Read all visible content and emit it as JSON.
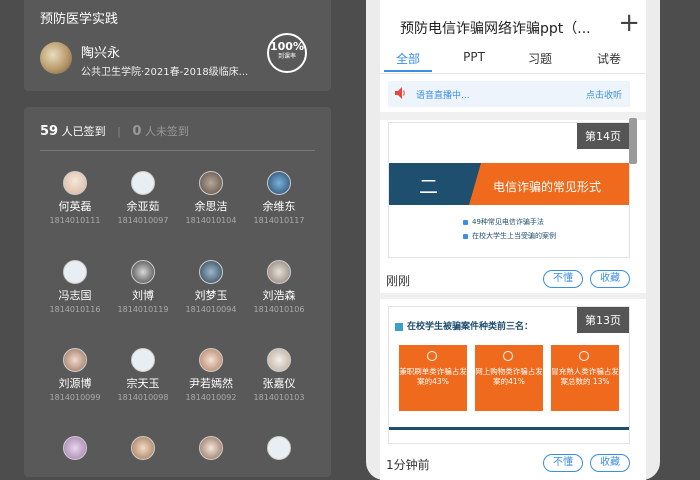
{
  "course": {
    "title": "预防医学实践",
    "teacher_name": "陶兴永",
    "teacher_info": "公共卫生学院·2021春-2018级临床...",
    "rate_value": "100%",
    "rate_label": "到课率"
  },
  "signin": {
    "signed_count": "59",
    "signed_label": "人已签到",
    "unsigned_count": "0",
    "unsigned_label": "人未签到"
  },
  "students": [
    {
      "name": "何英磊",
      "id": "1814010111"
    },
    {
      "name": "余亚茹",
      "id": "1814010097"
    },
    {
      "name": "余思洁",
      "id": "1814010104"
    },
    {
      "name": "余维东",
      "id": "1814010117"
    },
    {
      "name": "冯志国",
      "id": "1814010116"
    },
    {
      "name": "刘博",
      "id": "1814010119"
    },
    {
      "name": "刘梦玉",
      "id": "1814010094"
    },
    {
      "name": "刘浩森",
      "id": "1814010106"
    },
    {
      "name": "刘源博",
      "id": "1814010099"
    },
    {
      "name": "宗天玉",
      "id": "1814010098"
    },
    {
      "name": "尹若嫣然",
      "id": "1814010092"
    },
    {
      "name": "张嘉仪",
      "id": "1814010103"
    }
  ],
  "phone": {
    "title": "预防电信诈骗网络诈骗ppt（...",
    "plus_label": "+",
    "tabs": [
      "全部",
      "PPT",
      "习题",
      "试卷"
    ],
    "notice_text": "语音直播中...",
    "notice_action": "点击收听",
    "slide1": {
      "page": "第14页",
      "number": "二",
      "heading": "电信诈骗的常见形式",
      "bullet1": "49种常见电信诈骗手法",
      "bullet2": "在校大学生上当受骗的案例",
      "time": "刚刚",
      "btn_dont": "不懂",
      "btn_fav": "收藏"
    },
    "slide2": {
      "page": "第13页",
      "heading": "在校学生被骗案件种类前三名：",
      "box1": "兼职刷单类诈骗占发案的43%",
      "box2": "网上购物类诈骗占发案的41%",
      "box3": "冒充熟人类诈骗占发案总数的 13%",
      "time": "1分钟前",
      "btn_dont": "不懂",
      "btn_fav": "收藏"
    }
  }
}
